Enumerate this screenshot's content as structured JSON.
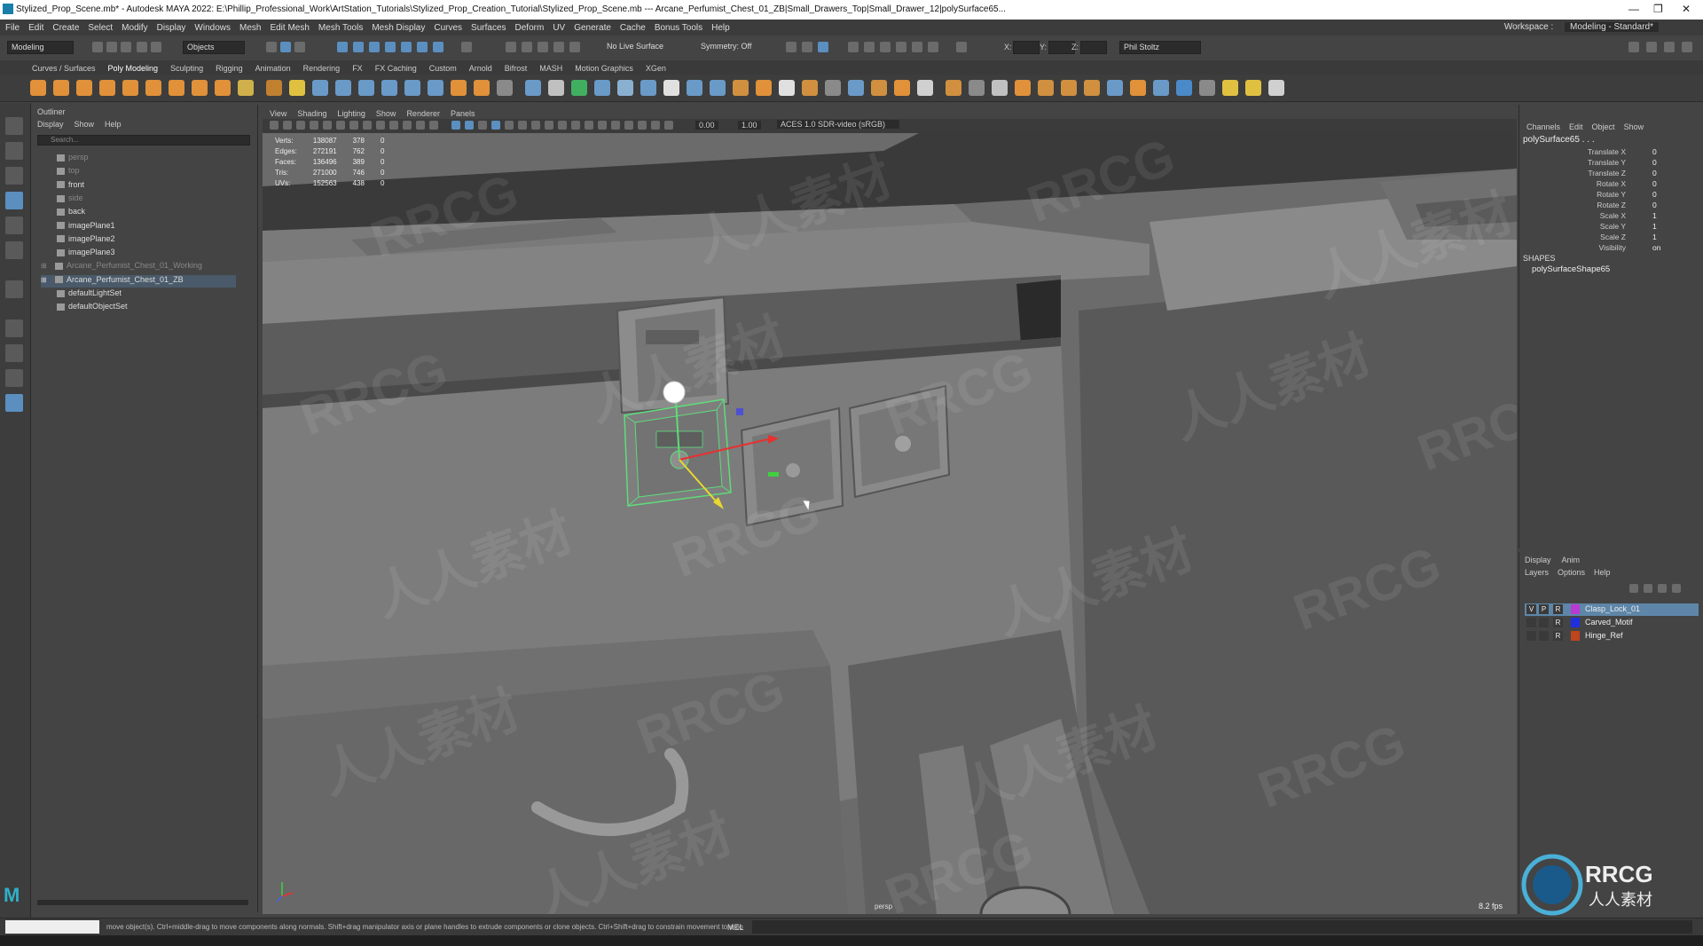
{
  "title_bar": {
    "title": "Stylized_Prop_Scene.mb* - Autodesk MAYA 2022: E:\\Phillip_Professional_Work\\ArtStation_Tutorials\\Stylized_Prop_Creation_Tutorial\\Stylized_Prop_Scene.mb --- Arcane_Perfumist_Chest_01_ZB|Small_Drawers_Top|Small_Drawer_12|polySurface65..."
  },
  "menubar": {
    "items": [
      "File",
      "Edit",
      "Create",
      "Select",
      "Modify",
      "Display",
      "Windows",
      "Mesh",
      "Edit Mesh",
      "Mesh Tools",
      "Mesh Display",
      "Curves",
      "Surfaces",
      "Deform",
      "UV",
      "Generate",
      "Cache",
      "Bonus Tools",
      "Help"
    ],
    "workspace_label": "Workspace :",
    "workspace_value": "Modeling - Standard*"
  },
  "status_line": {
    "menuset": "Modeling",
    "objects_mode": "Objects",
    "live_surface": "No Live Surface",
    "symmetry": "Symmetry: Off",
    "x_label": "X:",
    "y_label": "Y:",
    "z_label": "Z:",
    "user": "Phil Stoltz"
  },
  "shelf": {
    "tabs": [
      "Curves / Surfaces",
      "Poly Modeling",
      "Sculpting",
      "Rigging",
      "Animation",
      "Rendering",
      "FX",
      "FX Caching",
      "Custom",
      "Arnold",
      "Bifrost",
      "MASH",
      "Motion Graphics",
      "XGen"
    ]
  },
  "outliner": {
    "title": "Outliner",
    "menu": [
      "Display",
      "Show",
      "Help"
    ],
    "search_placeholder": "Search...",
    "items": [
      {
        "label": "persp",
        "dim": true
      },
      {
        "label": "top",
        "dim": true
      },
      {
        "label": "front",
        "dim": false
      },
      {
        "label": "side",
        "dim": true
      },
      {
        "label": "back",
        "dim": false
      },
      {
        "label": "imagePlane1",
        "dim": false
      },
      {
        "label": "imagePlane2",
        "dim": false
      },
      {
        "label": "imagePlane3",
        "dim": false
      },
      {
        "label": "Arcane_Perfumist_Chest_01_Working",
        "dim": true
      },
      {
        "label": "Arcane_Perfumist_Chest_01_ZB",
        "dim": false
      },
      {
        "label": "defaultLightSet",
        "dim": false
      },
      {
        "label": "defaultObjectSet",
        "dim": false
      }
    ]
  },
  "viewport": {
    "menu": [
      "View",
      "Shading",
      "Lighting",
      "Show",
      "Renderer",
      "Panels"
    ],
    "exposure": "0.00",
    "gamma": "1.00",
    "color_space": "ACES 1.0 SDR-video (sRGB)",
    "hud": [
      {
        "label": "Verts:",
        "a": "138087",
        "b": "378",
        "c": "0"
      },
      {
        "label": "Edges:",
        "a": "272191",
        "b": "762",
        "c": "0"
      },
      {
        "label": "Faces:",
        "a": "136496",
        "b": "389",
        "c": "0"
      },
      {
        "label": "Tris:",
        "a": "271000",
        "b": "746",
        "c": "0"
      },
      {
        "label": "UVs:",
        "a": "152563",
        "b": "438",
        "c": "0"
      }
    ],
    "camera": "persp",
    "fps": "8.2 fps",
    "watermarks": [
      "RRCG",
      "人人素材"
    ]
  },
  "channel_box": {
    "menu": [
      "Channels",
      "Edit",
      "Object",
      "Show"
    ],
    "object": "polySurface65 . . .",
    "attributes": [
      {
        "label": "Translate X",
        "value": "0"
      },
      {
        "label": "Translate Y",
        "value": "0"
      },
      {
        "label": "Translate Z",
        "value": "0"
      },
      {
        "label": "Rotate X",
        "value": "0"
      },
      {
        "label": "Rotate Y",
        "value": "0"
      },
      {
        "label": "Rotate Z",
        "value": "0"
      },
      {
        "label": "Scale X",
        "value": "1"
      },
      {
        "label": "Scale Y",
        "value": "1"
      },
      {
        "label": "Scale Z",
        "value": "1"
      },
      {
        "label": "Visibility",
        "value": "on"
      }
    ],
    "shapes_label": "SHAPES",
    "shape_name": "polySurfaceShape65"
  },
  "layer_editor": {
    "tabs": [
      "Display",
      "Anim"
    ],
    "menu": [
      "Layers",
      "Options",
      "Help"
    ],
    "layers": [
      {
        "v": "V",
        "p": "P",
        "r": "R",
        "name": "Clasp_Lock_01",
        "color": "#b83ad0",
        "selected": true
      },
      {
        "v": "",
        "p": "",
        "r": "R",
        "name": "Carved_Motif",
        "color": "#1f2fe0",
        "selected": false
      },
      {
        "v": "",
        "p": "",
        "r": "R",
        "name": "Hinge_Ref",
        "color": "#c0441e",
        "selected": false
      }
    ]
  },
  "help_line": {
    "text": "move object(s). Ctrl+middle-drag to move components along normals. Shift+drag manipulator axis or plane handles to extrude components or clone objects. Ctrl+Shift+drag to constrain movement to a co",
    "mel_label": "MEL"
  },
  "logo": {
    "brand": "RRCG",
    "sub": "人人素材"
  },
  "colors": {
    "accent": "#5a8fc0",
    "selection_green": "#5fdc7a",
    "viewport_bg": "#6a6a6a"
  }
}
